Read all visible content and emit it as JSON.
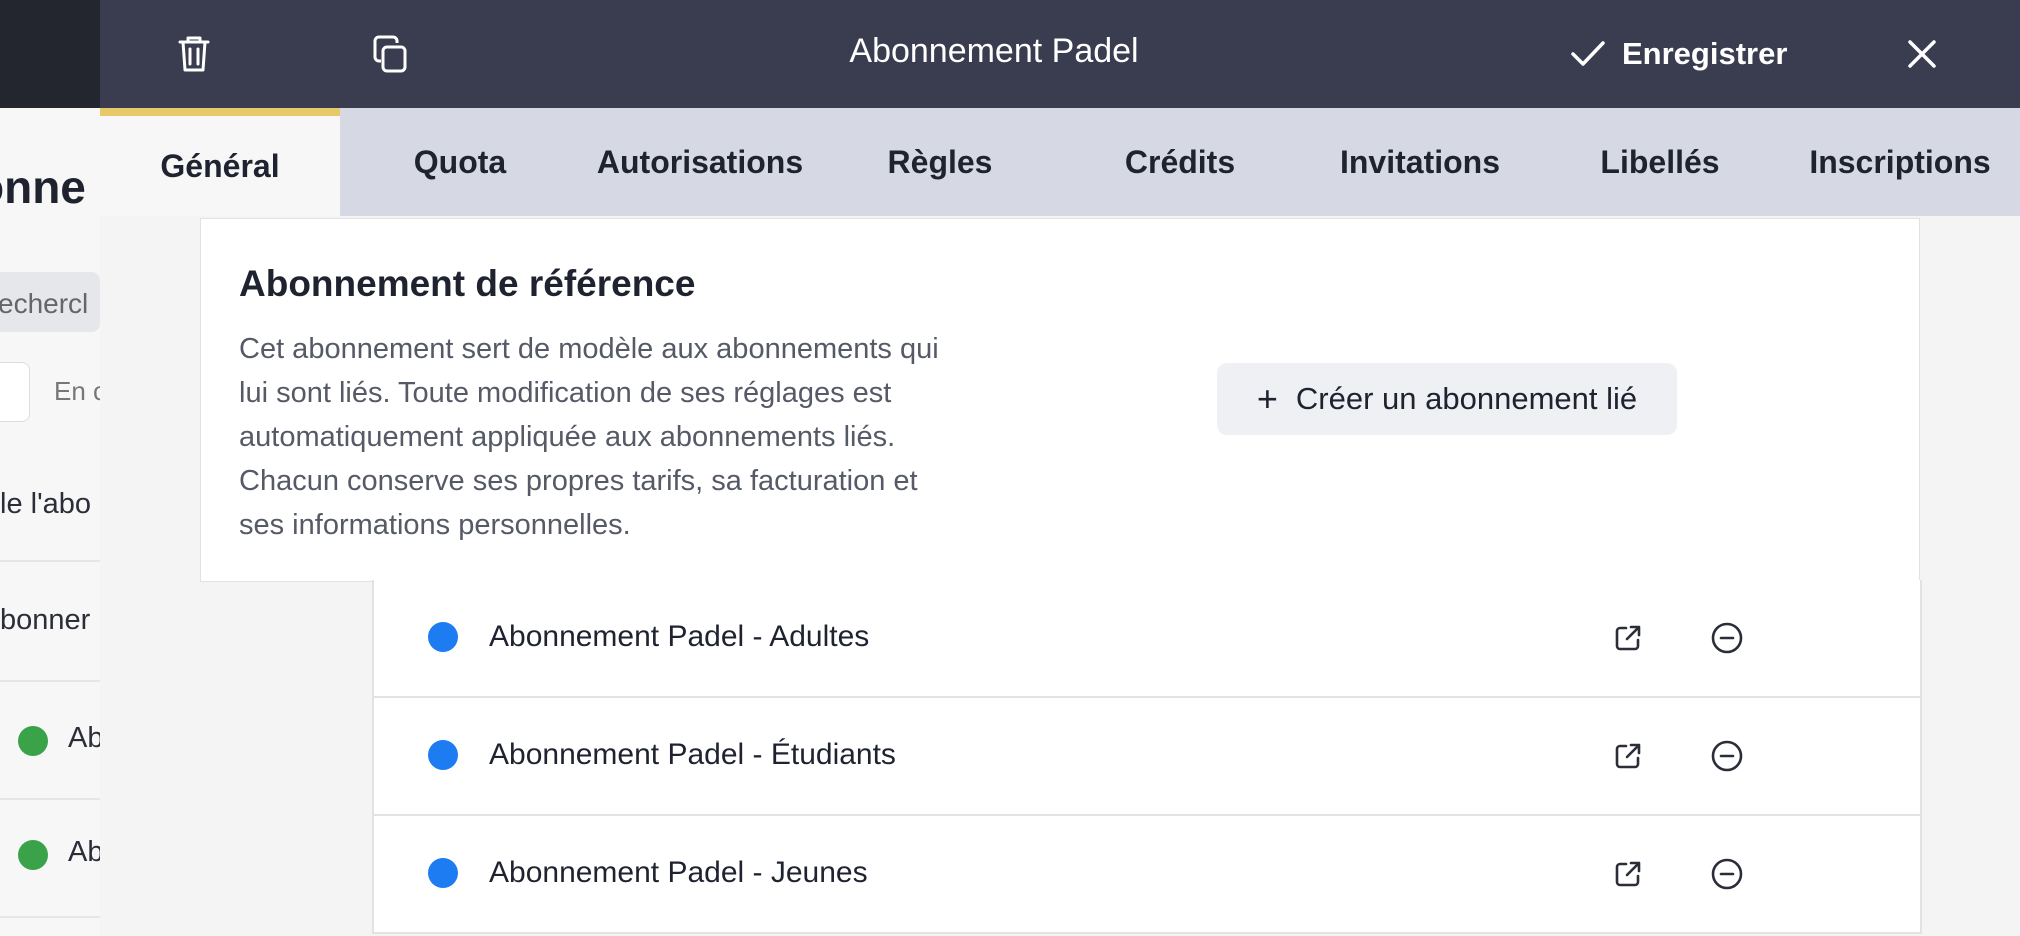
{
  "background_page": {
    "title_fragment": "onne",
    "search_fragment": "echercl",
    "filter_fragment": "En c",
    "column_fragment": "le l'abo",
    "row_fragment": "bonner",
    "list_rows": [
      "Ab",
      "Ab"
    ]
  },
  "drawer": {
    "title": "Abonnement Padel",
    "icons": {
      "delete": "trash-icon",
      "duplicate": "copy-icon",
      "save": "checkmark-icon",
      "close": "close-icon"
    },
    "save_label": "Enregistrer",
    "tabs": [
      {
        "label": "Général",
        "active": true
      },
      {
        "label": "Quota",
        "active": false
      },
      {
        "label": "Autorisations",
        "active": false
      },
      {
        "label": "Règles",
        "active": false
      },
      {
        "label": "Crédits",
        "active": false
      },
      {
        "label": "Invitations",
        "active": false
      },
      {
        "label": "Libellés",
        "active": false
      },
      {
        "label": "Inscriptions",
        "active": false
      }
    ]
  },
  "reference": {
    "title": "Abonnement de référence",
    "description": "Cet abonnement sert de modèle aux abonnements qui lui sont liés. Toute modification de ses réglages est automatiquement appliquée aux abonnements liés. Chacun conserve ses propres tarifs, sa facturation et ses informations personnelles.",
    "create_button_label": "Créer un abonnement lié"
  },
  "linked_subscriptions": [
    {
      "name": "Abonnement Padel - Adultes"
    },
    {
      "name": "Abonnement Padel - Étudiants"
    },
    {
      "name": "Abonnement Padel - Jeunes"
    }
  ],
  "colors": {
    "header_bg": "#3a3c4f",
    "tabs_bg": "#d6d9e3",
    "active_tab_accent": "#e8c96a",
    "linked_dot": "#1e7cf2",
    "background_status_dot": "#3aa34a"
  }
}
